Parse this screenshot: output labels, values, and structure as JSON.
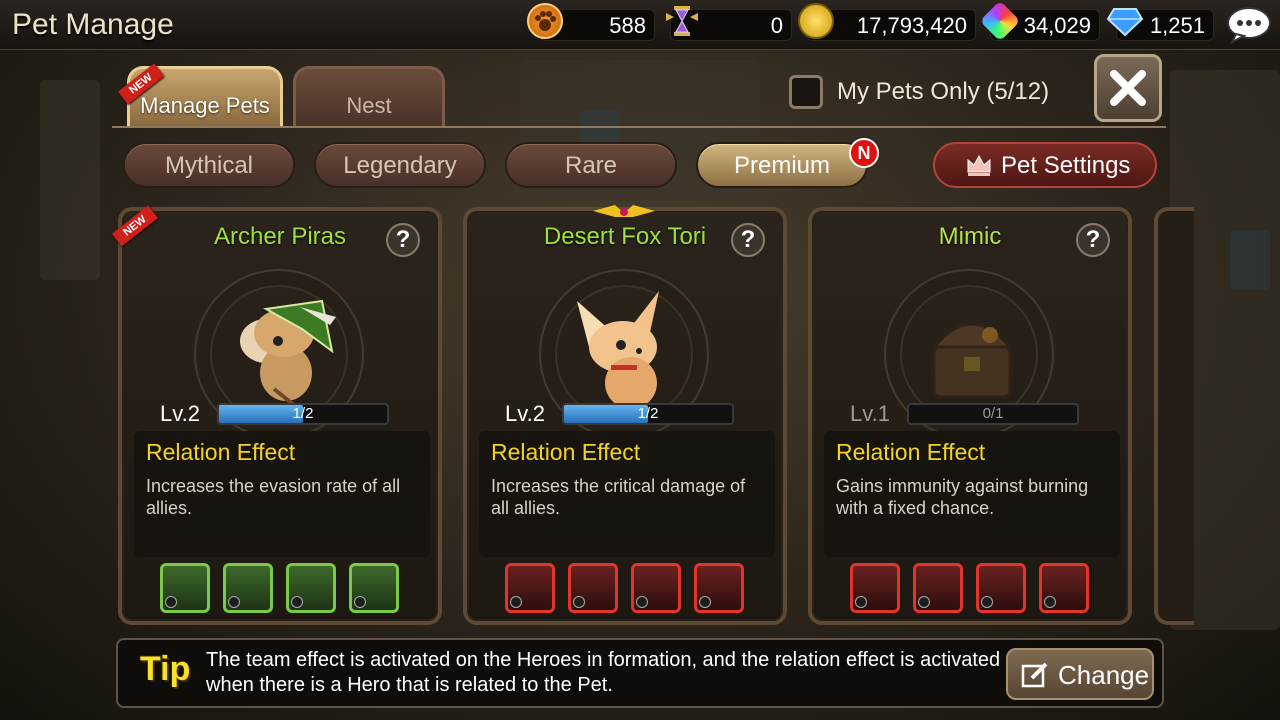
{
  "header": {
    "title": "Pet Manage",
    "resources": [
      {
        "icon": "paw-icon",
        "value": "588"
      },
      {
        "icon": "hourglass-icon",
        "value": "0"
      },
      {
        "icon": "gold-coin-icon",
        "value": "17,793,420"
      },
      {
        "icon": "rainbow-gem-icon",
        "value": "34,029"
      },
      {
        "icon": "diamond-icon",
        "value": "1,251"
      }
    ]
  },
  "tabs": {
    "manage_pets": "Manage Pets",
    "nest": "Nest",
    "new_ribbon": "NEW"
  },
  "filter_my_pets": {
    "label": "My Pets Only (5/12)",
    "checked": false
  },
  "filters": {
    "mythical": "Mythical",
    "legendary": "Legendary",
    "rare": "Rare",
    "premium": "Premium",
    "premium_badge": "N",
    "active": "Premium"
  },
  "pet_settings": "Pet Settings",
  "cards": [
    {
      "name": "Archer Piras",
      "ribbon": "NEW",
      "level": "Lv.2",
      "progress": "1/2",
      "progress_fraction": 0.5,
      "effect_title": "Relation Effect",
      "effect_desc": "Increases the evasion rate of all allies.",
      "heroes_color": "green"
    },
    {
      "name": "Desert Fox Tori",
      "level": "Lv.2",
      "progress": "1/2",
      "progress_fraction": 0.5,
      "effect_title": "Relation Effect",
      "effect_desc": "Increases the critical damage of all allies.",
      "heroes_color": "red"
    },
    {
      "name": "Mimic",
      "level": "Lv.1",
      "progress": "0/1",
      "progress_fraction": 0,
      "effect_title": "Relation Effect",
      "effect_desc": "Gains immunity against burning with a fixed chance.",
      "heroes_color": "red"
    }
  ],
  "tip": {
    "label": "Tip",
    "text": "The team effect is activated on the Heroes in formation, and the relation effect is activated when there is a Hero that is related to the Pet.",
    "change": "Change"
  },
  "colors": {
    "pet_name": "#9fe03a",
    "effect_title": "#f3d322",
    "tip_label": "#f8e12a",
    "new_ribbon": "#d0201a"
  }
}
